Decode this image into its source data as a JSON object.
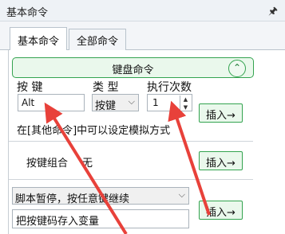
{
  "window": {
    "title": "基本命令",
    "pin_icon": "pin-icon"
  },
  "tabs": [
    {
      "label": "基本命令",
      "active": true
    },
    {
      "label": "全部命令",
      "active": false
    }
  ],
  "keyboard_section": {
    "title": "键盘命令",
    "collapse_icon": "double-chevron-up-icon",
    "col_key": "按 键",
    "col_type": "类 型",
    "col_times": "执行次数",
    "key_value": "Alt",
    "type_value": "按键",
    "times_value": "1",
    "insert_label": "插入→",
    "note": "在[其他命令]中可以设定模拟方式"
  },
  "key_combo": {
    "label": "按键组合",
    "value": "无",
    "insert_label": "插入→"
  },
  "script_pause": {
    "selected": "脚本暂停，按任意键继续",
    "store_label": "把按键码存入变量",
    "insert_label": "插入→"
  },
  "colors": {
    "accent": "#33a34f",
    "accent_bg": "#eaf8ec",
    "arrow": "#e8413a"
  }
}
